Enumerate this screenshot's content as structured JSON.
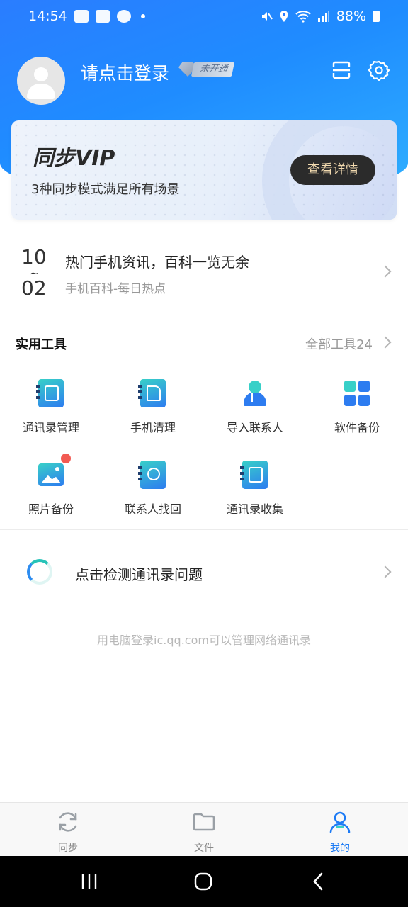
{
  "status_bar": {
    "time": "14:54",
    "battery": "88%"
  },
  "profile": {
    "login_prompt": "请点击登录",
    "vip_status": "未开通",
    "icons": [
      "scan-icon",
      "settings-icon"
    ]
  },
  "vip_card": {
    "title": "同步VIP",
    "subtitle": "3种同步模式满足所有场景",
    "button": "查看详情"
  },
  "news": {
    "month": "10",
    "separator": "~",
    "day": "02",
    "title": "热门手机资讯，百科一览无余",
    "subtitle": "手机百科-每日热点"
  },
  "tools": {
    "title": "实用工具",
    "all_label": "全部工具24",
    "items": [
      {
        "label": "通讯录管理",
        "icon": "contacts-book-icon"
      },
      {
        "label": "手机清理",
        "icon": "phone-clean-icon"
      },
      {
        "label": "导入联系人",
        "icon": "import-contact-icon"
      },
      {
        "label": "软件备份",
        "icon": "app-backup-icon"
      },
      {
        "label": "照片备份",
        "icon": "photo-backup-icon"
      },
      {
        "label": "联系人找回",
        "icon": "contact-recover-icon"
      },
      {
        "label": "通讯录收集",
        "icon": "contacts-collect-icon"
      }
    ]
  },
  "detect": {
    "label": "点击检测通讯录问题"
  },
  "hint": "用电脑登录ic.qq.com可以管理网络通讯录",
  "bottom_nav": [
    {
      "label": "同步",
      "icon": "sync-icon"
    },
    {
      "label": "文件",
      "icon": "folder-icon"
    },
    {
      "label": "我的",
      "icon": "profile-icon",
      "active": true
    }
  ],
  "colors": {
    "brand_blue": "#1f8cff",
    "accent_teal": "#38d0c8",
    "active_tab": "#1d7bf5",
    "badge_red": "#f25a52"
  }
}
